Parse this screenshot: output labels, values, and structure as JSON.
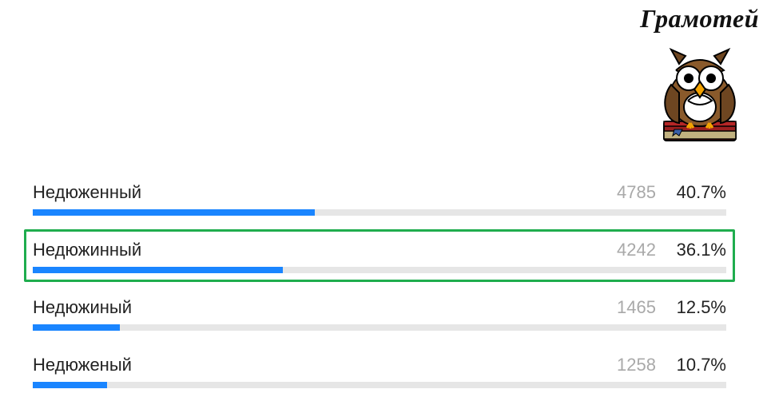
{
  "logo": {
    "text": "Грамотей"
  },
  "options": [
    {
      "label": "Недюженный",
      "count": "4785",
      "percent": "40.7%",
      "fill": 40.7,
      "correct": false
    },
    {
      "label": "Недюжинный",
      "count": "4242",
      "percent": "36.1%",
      "fill": 36.1,
      "correct": true
    },
    {
      "label": "Недюжиный",
      "count": "1465",
      "percent": "12.5%",
      "fill": 12.5,
      "correct": false
    },
    {
      "label": "Недюженый",
      "count": "1258",
      "percent": "10.7%",
      "fill": 10.7,
      "correct": false
    }
  ],
  "chart_data": {
    "type": "bar",
    "title": "Грамотей",
    "categories": [
      "Недюженный",
      "Недюжинный",
      "Недюжиный",
      "Недюженый"
    ],
    "series": [
      {
        "name": "votes",
        "values": [
          4785,
          4242,
          1465,
          1258
        ]
      },
      {
        "name": "percent",
        "values": [
          40.7,
          36.1,
          12.5,
          10.7
        ]
      }
    ],
    "highlight_index": 1,
    "xlabel": "",
    "ylabel": "",
    "ylim": [
      0,
      100
    ]
  }
}
